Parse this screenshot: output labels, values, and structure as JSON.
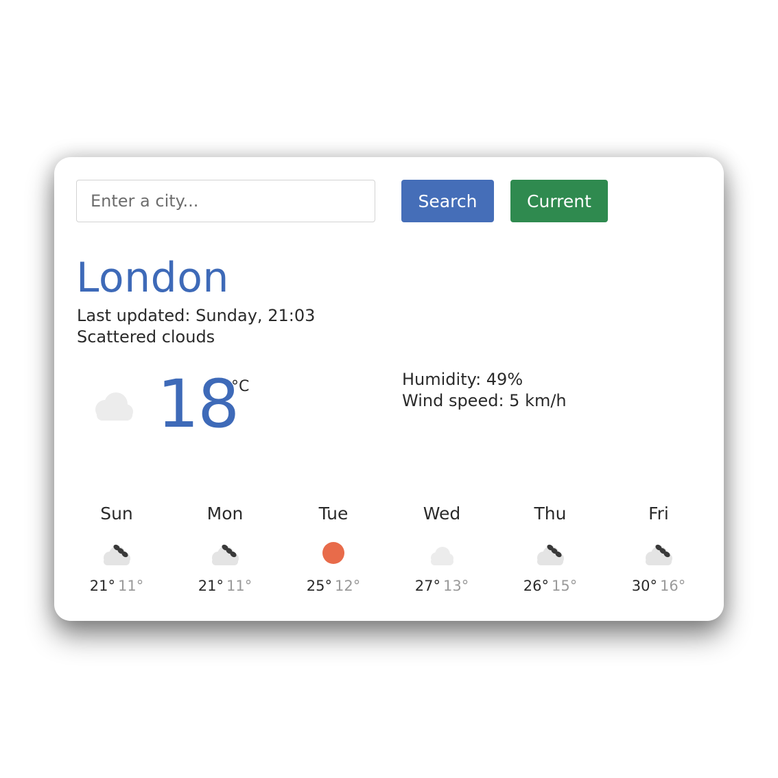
{
  "search": {
    "placeholder": "Enter a city...",
    "search_label": "Search",
    "current_label": "Current"
  },
  "current": {
    "city": "London",
    "last_updated": "Last updated: Sunday, 21:03",
    "description": "Scattered clouds",
    "icon": "cloud-icon",
    "temperature": "18",
    "unit": "°C",
    "humidity": "Humidity: 49%",
    "wind": "Wind speed: 5 km/h"
  },
  "forecast": [
    {
      "day": "Sun",
      "icon": "rain-cloud-icon",
      "high": "21°",
      "low": "11°"
    },
    {
      "day": "Mon",
      "icon": "rain-cloud-icon",
      "high": "21°",
      "low": "11°"
    },
    {
      "day": "Tue",
      "icon": "sun-icon",
      "high": "25°",
      "low": "12°"
    },
    {
      "day": "Wed",
      "icon": "cloud-icon",
      "high": "27°",
      "low": "13°"
    },
    {
      "day": "Thu",
      "icon": "rain-cloud-icon",
      "high": "26°",
      "low": "15°"
    },
    {
      "day": "Fri",
      "icon": "rain-cloud-icon",
      "high": "30°",
      "low": "16°"
    }
  ],
  "colors": {
    "accent": "#3e6ab8",
    "search_button": "#456eb8",
    "current_button": "#2f8a4f",
    "sun": "#e86b4a",
    "cloud": "#ececec"
  }
}
